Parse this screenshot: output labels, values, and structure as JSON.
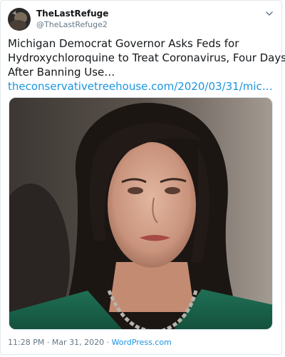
{
  "author": {
    "display_name": "TheLastRefuge",
    "handle": "@TheLastRefuge2"
  },
  "tweet": {
    "text_lines": [
      "Michigan Democrat Governor Asks Feds for",
      "Hydroxychloroquine to Treat Coronavirus, Four Days",
      "After Banning Use…"
    ],
    "link_text": "theconservativetreehouse.com/2020/03/31/mic…"
  },
  "footer": {
    "time": "11:28 PM",
    "separator": " · ",
    "date": "Mar 31, 2020",
    "source": "WordPress.com"
  },
  "icons": {
    "menu": "chevron-down-icon",
    "avatar": "profile-avatar"
  },
  "colors": {
    "link": "#1b95e0",
    "text": "#14171a",
    "muted": "#657786",
    "border": "#e1e8ed"
  }
}
